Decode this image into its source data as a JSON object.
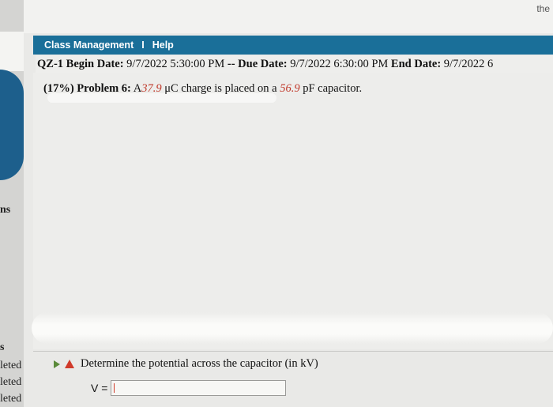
{
  "top_corner": "the",
  "left_fragments": [
    "ns",
    "s",
    "leted",
    "leted",
    "leted"
  ],
  "nav": {
    "class_management": "Class Management",
    "separator": "I",
    "help": "Help"
  },
  "quiz": {
    "name": "QZ-1",
    "begin_label": "Begin Date:",
    "begin_value": "9/7/2022 5:30:00 PM",
    "sep": "--",
    "due_label": "Due Date:",
    "due_value": "9/7/2022 6:30:00 PM",
    "end_label": "End Date:",
    "end_value": "9/7/2022 6"
  },
  "problem": {
    "percent": "(17%)",
    "label": "Problem 6:",
    "text_a": "A",
    "charge": "37.9",
    "text_b": "μC charge is placed on a",
    "capacitance": "56.9",
    "text_c": "pF capacitor."
  },
  "part": {
    "question": "Determine the potential across the capacitor (in kV)",
    "answer_label": "V =",
    "answer_value": ""
  },
  "colors": {
    "nav_bar": "#1a6f99",
    "highlight_value": "#c0392b",
    "warning": "#d03a2a"
  }
}
